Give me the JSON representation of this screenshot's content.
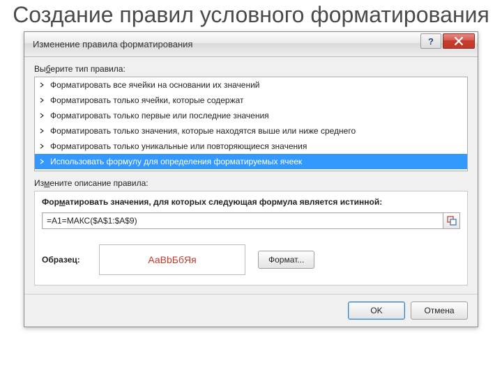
{
  "slide": {
    "title": "Создание правил условного форматирования"
  },
  "dialog": {
    "title": "Изменение правила форматирования",
    "help_symbol": "?",
    "select_rule_label_pre": "Вы",
    "select_rule_label_u": "б",
    "select_rule_label_post": "ерите тип правила:",
    "rule_types": [
      {
        "label": "Форматировать все ячейки на основании их значений",
        "selected": false
      },
      {
        "label": "Форматировать только ячейки, которые содержат",
        "selected": false
      },
      {
        "label": "Форматировать только первые или последние значения",
        "selected": false
      },
      {
        "label": "Форматировать только значения, которые находятся выше или ниже среднего",
        "selected": false
      },
      {
        "label": "Форматировать только уникальные или повторяющиеся значения",
        "selected": false
      },
      {
        "label": "Использовать формулу для определения форматируемых ячеек",
        "selected": true
      }
    ],
    "edit_desc_label_pre": "Из",
    "edit_desc_label_u": "м",
    "edit_desc_label_post": "ените описание правила:",
    "formula_heading_pre": "Фор",
    "formula_heading_u": "м",
    "formula_heading_post": "атировать значения, для которых следующая формула является истинной:",
    "formula_value": "=A1=МАКС($A$1:$A$9)",
    "preview_label": "Образец:",
    "preview_text": "АаBbБбЯя",
    "format_button": "Формат...",
    "ok_button": "OK",
    "cancel_button": "Отмена",
    "colors": {
      "preview_text_color": "#c0392b"
    }
  }
}
